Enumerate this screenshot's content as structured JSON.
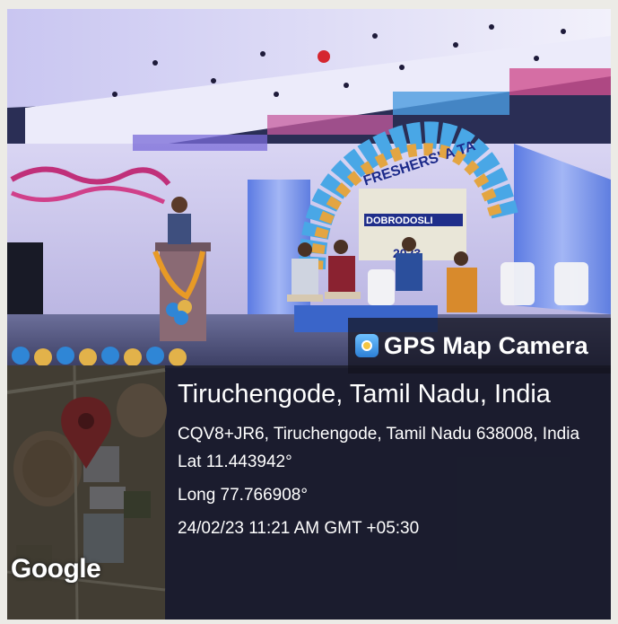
{
  "badge": {
    "label": "GPS Map Camera",
    "icon": "map-pin-camera-icon"
  },
  "map": {
    "provider_logo": "Google",
    "pin_icon": "location-pin-icon",
    "pin_color": "#e53935"
  },
  "location": {
    "title": "Tiruchengode, Tamil Nadu, India",
    "address": "CQV8+JR6, Tiruchengode, Tamil Nadu 638008, India",
    "latitude": "Lat 11.443942°",
    "longitude": "Long 77.766908°",
    "datetime": "24/02/23 11:21 AM GMT +05:30"
  },
  "stage": {
    "banner_text": "FRESHERS' A TA",
    "banner_subtext": "DOBRODOSLI",
    "year": "2023"
  }
}
